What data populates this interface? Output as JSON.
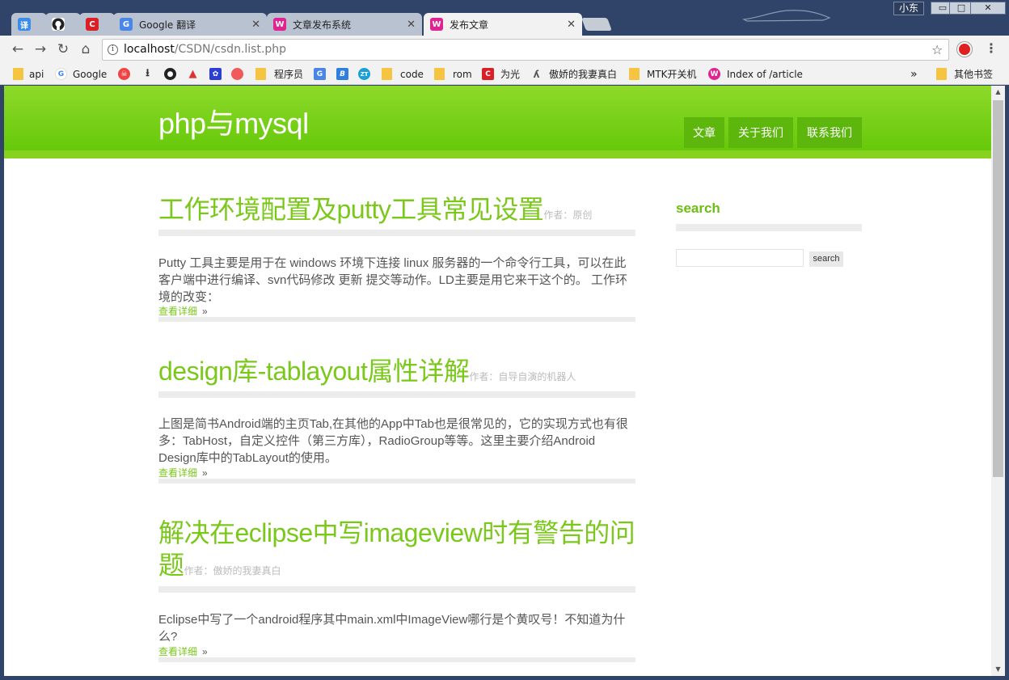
{
  "browser": {
    "tabs": [
      {
        "label": "",
        "favicon": "译",
        "favicon_color": "#3b8ce8"
      },
      {
        "label": "",
        "favicon": "github",
        "favicon_color": "#222222"
      },
      {
        "label": "",
        "favicon": "C",
        "favicon_color": "#d92027"
      },
      {
        "label": "Google 翻译",
        "favicon": "translate",
        "favicon_color": "#4a86e8"
      },
      {
        "label": "文章发布系统",
        "favicon": "W",
        "favicon_color": "#e02390"
      },
      {
        "label": "发布文章",
        "favicon": "W",
        "favicon_color": "#e02390"
      }
    ],
    "user_badge": "小东",
    "url_host": "localhost",
    "url_path": "/CSDN/csdn.list.php",
    "bookmarks": [
      {
        "label": "api",
        "icon": "folder"
      },
      {
        "label": "Google",
        "icon": "google-icon"
      },
      {
        "label": "",
        "icon": "skull-icon"
      },
      {
        "label": "",
        "icon": "download-icon"
      },
      {
        "label": "",
        "icon": "github-icon"
      },
      {
        "label": "",
        "icon": "flame-icon"
      },
      {
        "label": "",
        "icon": "paw-icon"
      },
      {
        "label": "",
        "icon": "circle-icon"
      },
      {
        "label": "程序员",
        "icon": "folder"
      },
      {
        "label": "",
        "icon": "translate-icon"
      },
      {
        "label": "",
        "icon": "b-icon"
      },
      {
        "label": "",
        "icon": "zt-icon"
      },
      {
        "label": "code",
        "icon": "folder"
      },
      {
        "label": "rom",
        "icon": "folder"
      },
      {
        "label": "为光",
        "icon": "c-icon"
      },
      {
        "label": "傲娇的我妻真白",
        "icon": "signature-icon"
      },
      {
        "label": "MTK开关机",
        "icon": "folder"
      },
      {
        "label": "Index of /article",
        "icon": "w-icon"
      }
    ],
    "overflow": "»",
    "other_bookmarks": "其他书签"
  },
  "site": {
    "title": "php与mysql",
    "menu": [
      "文章",
      "关于我们",
      "联系我们"
    ]
  },
  "posts": [
    {
      "title": "工作环境配置及putty工具常见设置",
      "author": "作者：原创",
      "excerpt": "Putty 工具主要是用于在 windows 环境下连接 linux 服务器的一个命令行工具，可以在此客户端中进行编译、svn代码修改 更新 提交等动作。LD主要是用它来干这个的。 工作环境的改变：",
      "more": "查看详细",
      "more_arrow": "»"
    },
    {
      "title": "design库-tablayout属性详解",
      "author": "作者：自导自演的机器人",
      "excerpt": "上图是简书Android端的主页Tab,在其他的App中Tab也是很常见的，它的实现方式也有很多：TabHost，自定义控件（第三方库），RadioGroup等等。这里主要介绍Android Design库中的TabLayout的使用。",
      "more": "查看详细",
      "more_arrow": "»"
    },
    {
      "title": "解决在eclipse中写imageview时有警告的问题",
      "author": "作者：傲娇的我妻真白",
      "excerpt": "Eclipse中写了一个android程序其中main.xml中ImageView哪行是个黄叹号！不知道为什么?",
      "more": "查看详细",
      "more_arrow": "»"
    }
  ],
  "sidebar": {
    "title": "search",
    "search_value": "",
    "search_button": "search"
  },
  "colors": {
    "brand_green": "#7ac81a",
    "header_top": "#8ed92a",
    "header_bottom": "#66c90a",
    "menu_bg": "#5cb60c",
    "chrome_frame": "#2f4468"
  }
}
